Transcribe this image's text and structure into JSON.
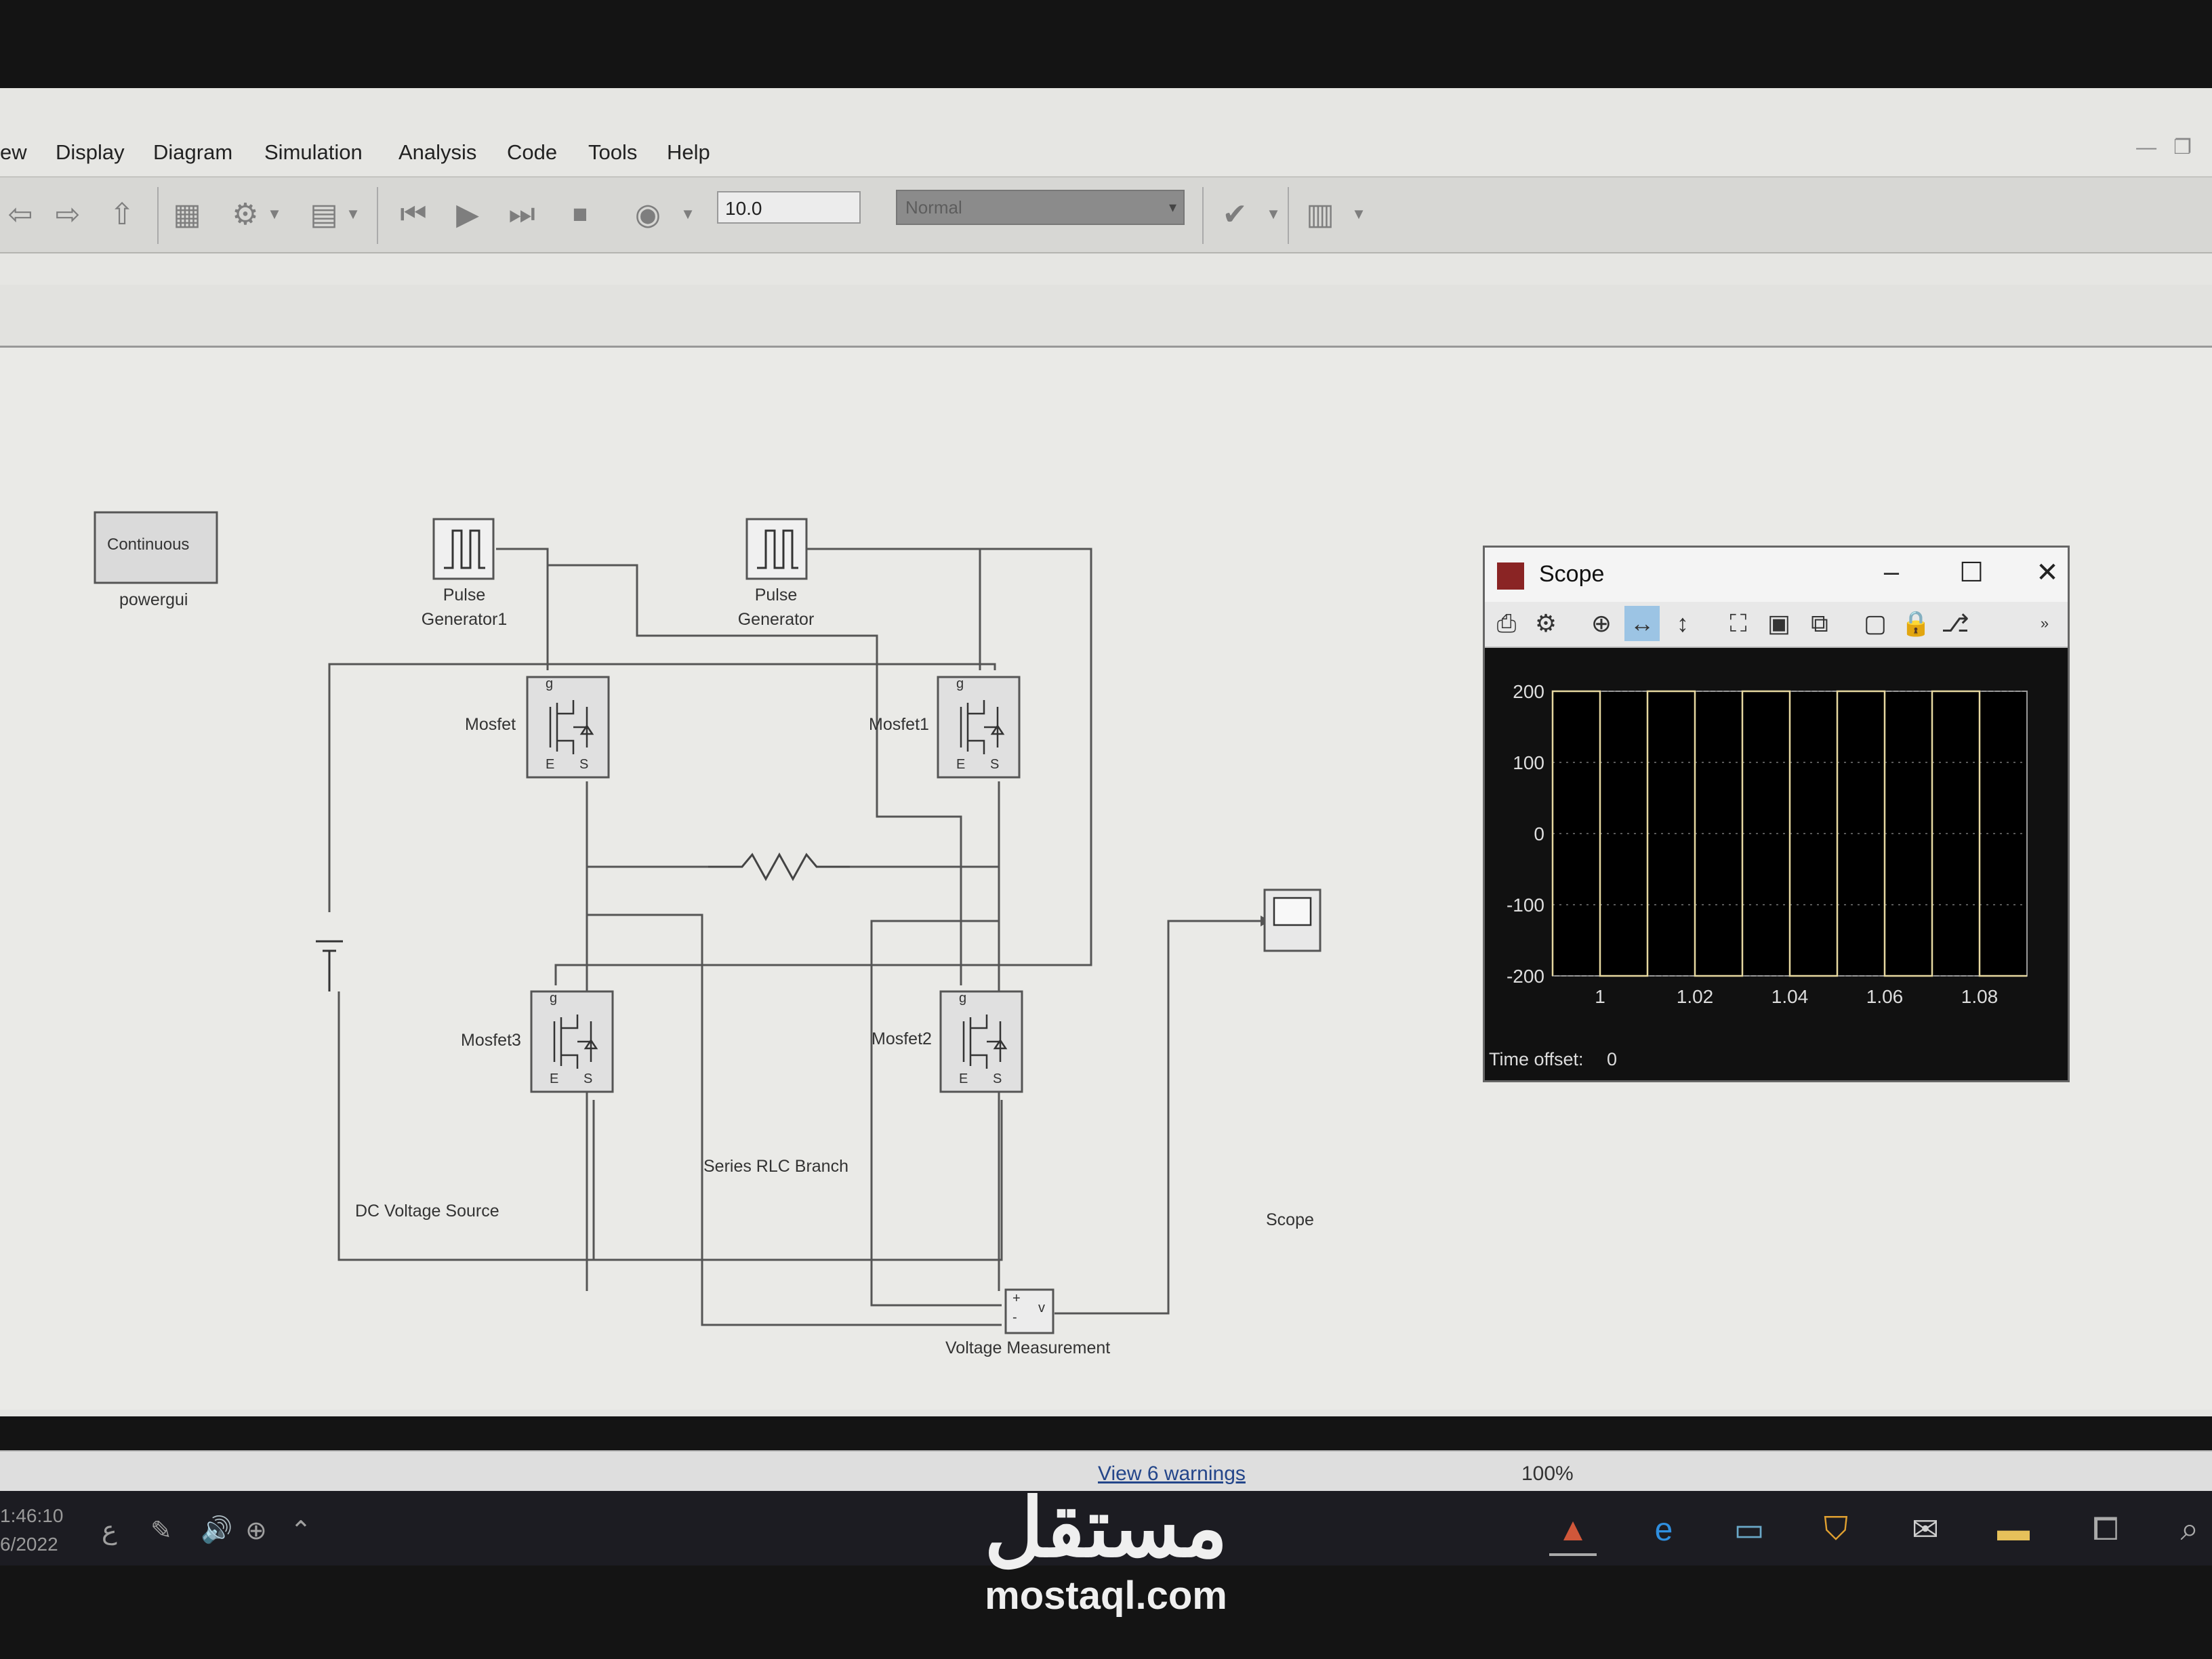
{
  "menu": [
    "ew",
    "Display",
    "Diagram",
    "Simulation",
    "Analysis",
    "Code",
    "Tools",
    "Help"
  ],
  "toolbar": {
    "stop_time": "10.0",
    "sim_mode": "Normal",
    "icons": [
      "back-arrow-icon",
      "forward-arrow-icon",
      "up-arrow-icon",
      "library-browser-icon",
      "settings-gear-icon",
      "model-config-icon",
      "step-back-icon",
      "run-icon",
      "step-forward-icon",
      "stop-icon",
      "record-icon",
      "model-advisor-icon",
      "build-icon"
    ]
  },
  "model": {
    "blocks": {
      "powergui_title": "Continuous",
      "powergui_name": "powergui",
      "pulse_gen1": [
        "Pulse",
        "Generator1"
      ],
      "pulse_gen": [
        "Pulse",
        "Generator"
      ],
      "mosfet": "Mosfet",
      "mosfet1": "Mosfet1",
      "mosfet2": "Mosfet2",
      "mosfet3": "Mosfet3",
      "rlc": "Series RLC Branch",
      "dc_source": "DC Voltage Source",
      "scope": "Scope",
      "vmeas": "Voltage Measurement",
      "port_g": "g",
      "port_e": "E",
      "port_s": "S",
      "vm_plus": "+",
      "vm_minus": "-",
      "vm_v": "v"
    }
  },
  "statusbar": {
    "warnings": "View 6 warnings",
    "zoom": "100%"
  },
  "taskbar": {
    "clock_time": "1:46:10",
    "clock_date": "6/2022",
    "tray_lang": "ع"
  },
  "scope_window": {
    "title": "Scope",
    "time_offset_label": "Time offset:",
    "time_offset_value": "0",
    "chart_data": {
      "type": "line",
      "x_ticks": [
        "1",
        "1.02",
        "1.04",
        "1.06",
        "1.08"
      ],
      "y_ticks": [
        "200",
        "100",
        "0",
        "-100",
        "-200"
      ],
      "xlim": [
        0.99,
        1.09
      ],
      "ylim": [
        -200,
        200
      ],
      "grid": true,
      "series": [
        {
          "color": "#e6d8a0",
          "x": [
            0.99,
            0.99,
            1.0,
            1.0,
            1.01,
            1.01,
            1.02,
            1.02,
            1.03,
            1.03,
            1.04,
            1.04,
            1.05,
            1.05,
            1.06,
            1.06,
            1.07,
            1.07,
            1.08,
            1.08,
            1.09
          ],
          "y": [
            -200,
            200,
            200,
            -200,
            -200,
            200,
            200,
            -200,
            -200,
            200,
            200,
            -200,
            -200,
            200,
            200,
            -200,
            -200,
            200,
            200,
            -200,
            -200
          ]
        }
      ]
    }
  },
  "watermark": {
    "arabic": "مستقل",
    "latin": "mostaql.com"
  }
}
